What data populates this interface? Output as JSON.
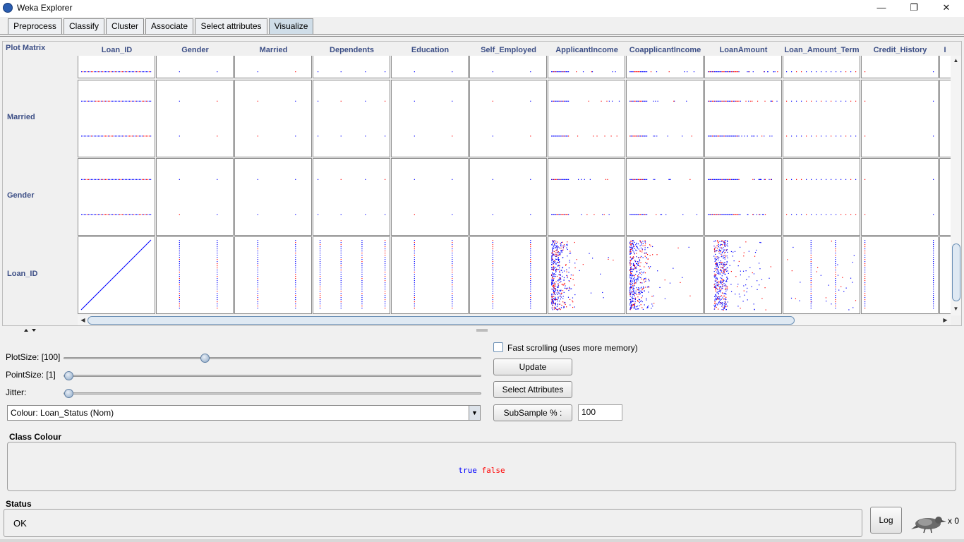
{
  "window": {
    "title": "Weka Explorer",
    "controls": {
      "minimize": "—",
      "maximize": "❐",
      "close": "✕"
    },
    "icon": "weka-icon"
  },
  "tabs": [
    {
      "label": "Preprocess",
      "active": false
    },
    {
      "label": "Classify",
      "active": false
    },
    {
      "label": "Cluster",
      "active": false
    },
    {
      "label": "Associate",
      "active": false
    },
    {
      "label": "Select attributes",
      "active": false
    },
    {
      "label": "Visualize",
      "active": true
    }
  ],
  "plot_matrix": {
    "label": "Plot Matrix",
    "columns": [
      "Loan_ID",
      "Gender",
      "Married",
      "Dependents",
      "Education",
      "Self_Employed",
      "ApplicantIncome",
      "CoapplicantIncome",
      "LoanAmount",
      "Loan_Amount_Term",
      "Credit_History",
      "I"
    ],
    "rows": [
      "Married",
      "Gender",
      "Loan_ID"
    ],
    "colors": {
      "true": "#0000ff",
      "false": "#ff0000"
    }
  },
  "controls": {
    "plot_size_label": "PlotSize: [100]",
    "plot_size_value": 100,
    "plot_size_fraction": 0.33,
    "point_size_label": "PointSize: [1]",
    "point_size_value": 1,
    "jitter_label": "Jitter:",
    "jitter_value": 0,
    "colour_label": "Colour: Loan_Status  (Nom)",
    "fast_scrolling_label": "Fast scrolling (uses more memory)",
    "fast_scrolling_checked": false,
    "update_label": "Update",
    "select_attributes_label": "Select Attributes",
    "subsample_label": "SubSample % :",
    "subsample_value": "100"
  },
  "class_colour": {
    "title": "Class Colour",
    "classes": [
      {
        "label": "true",
        "color": "#0000ff"
      },
      {
        "label": "false",
        "color": "#ff0000"
      }
    ]
  },
  "status": {
    "title": "Status",
    "text": "OK",
    "log_label": "Log",
    "tasks": "x 0"
  }
}
